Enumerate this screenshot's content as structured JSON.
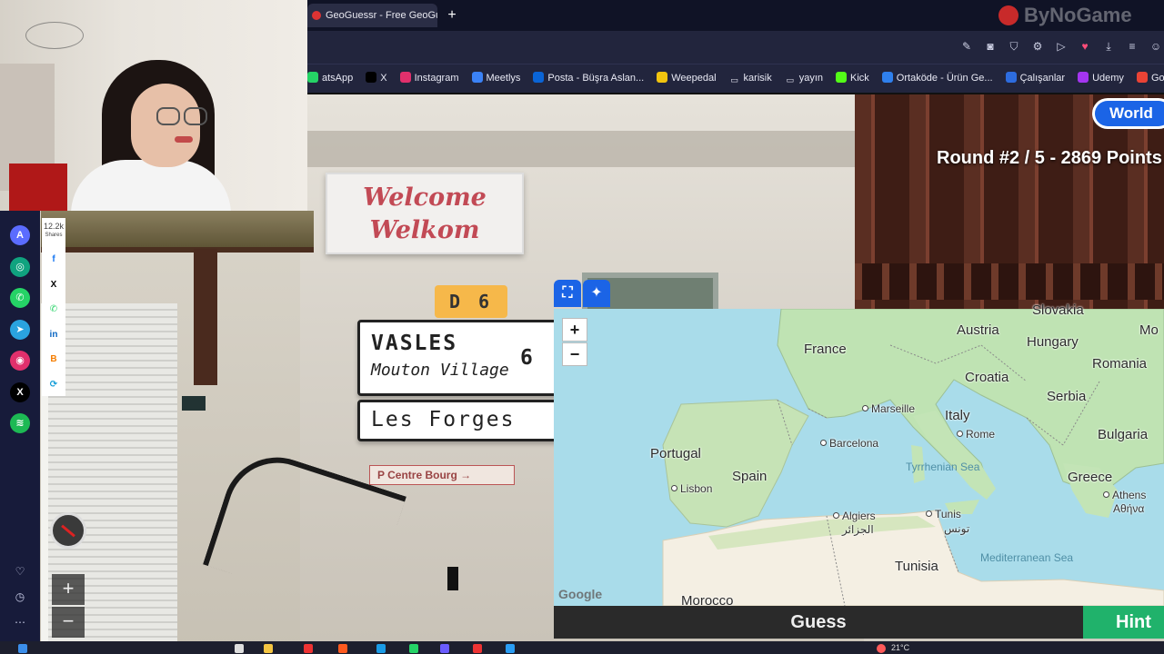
{
  "browser": {
    "active_tab_title": "GeoGuessr - Free GeoGu",
    "new_tab": "+",
    "watermark": "ByNoGame",
    "toolbar_icons": [
      "edit-icon",
      "camera-icon",
      "shield-icon",
      "translate-icon",
      "play-icon",
      "heart-icon",
      "download-icon",
      "menu-icon",
      "profile-icon"
    ]
  },
  "bookmarks": [
    {
      "label": "atsApp",
      "icon": "whatsapp-icon",
      "color": "#25d366"
    },
    {
      "label": "X",
      "icon": "x-icon",
      "color": "#000000"
    },
    {
      "label": "Instagram",
      "icon": "instagram-icon",
      "color": "#e1306c"
    },
    {
      "label": "Meetlys",
      "icon": "meetlys-icon",
      "color": "#3b82f6"
    },
    {
      "label": "Posta - Büşra Aslan...",
      "icon": "outlook-icon",
      "color": "#0a64d6"
    },
    {
      "label": "Weepedal",
      "icon": "weepedal-icon",
      "color": "#f1c40f"
    },
    {
      "label": "karisik",
      "icon": "folder-icon",
      "color": "#22253d"
    },
    {
      "label": "yayın",
      "icon": "folder-icon",
      "color": "#22253d"
    },
    {
      "label": "Kick",
      "icon": "kick-icon",
      "color": "#53fc18"
    },
    {
      "label": "Ortaköde - Ürün Ge...",
      "icon": "ortakode-icon",
      "color": "#2f80ed"
    },
    {
      "label": "Çalışanlar",
      "icon": "calendar-icon",
      "color": "#2d6cdf"
    },
    {
      "label": "Udemy",
      "icon": "udemy-icon",
      "color": "#a435f0"
    },
    {
      "label": "Google Haritalar",
      "icon": "maps-pin-icon",
      "color": "#ea4335"
    }
  ],
  "share": {
    "count": "12.2k",
    "count_label": "Shares",
    "sidebar_icons": [
      {
        "icon": "arc-icon",
        "color": "#5b6cff",
        "glyph": "A"
      },
      {
        "icon": "chatgpt-icon",
        "color": "#10a37f",
        "glyph": "◎"
      },
      {
        "icon": "whatsapp-icon",
        "color": "#25d366",
        "glyph": "✆"
      },
      {
        "icon": "telegram-icon",
        "color": "#2aa3df",
        "glyph": "➤"
      },
      {
        "icon": "instagram-icon",
        "color": "#e1306c",
        "glyph": "◉"
      },
      {
        "icon": "x-icon",
        "color": "#000000",
        "glyph": "X"
      },
      {
        "icon": "spotify-icon",
        "color": "#1db954",
        "glyph": "≋"
      }
    ],
    "panel_icons": [
      {
        "icon": "facebook-icon",
        "color": "#1877f2",
        "glyph": "f"
      },
      {
        "icon": "x-icon",
        "color": "#000000",
        "glyph": "X"
      },
      {
        "icon": "whatsapp-icon",
        "color": "#25d366",
        "glyph": "✆"
      },
      {
        "icon": "linkedin-icon",
        "color": "#0a66c2",
        "glyph": "in"
      },
      {
        "icon": "blogger-icon",
        "color": "#f57d00",
        "glyph": "B"
      },
      {
        "icon": "share-icon",
        "color": "#0f9bd7",
        "glyph": "⟳"
      }
    ]
  },
  "scene": {
    "welcome_line1": "Welcome",
    "welcome_line2": "Welkom",
    "road_number": "D 6",
    "sign1_town": "VASLES",
    "sign1_sub": "Mouton Village",
    "sign1_distance": "6",
    "sign2_town": "Les Forges",
    "sign3": "P Centre Bourg →"
  },
  "game": {
    "mode_button": "World",
    "round_info": "Round #2 / 5 - 2869 Points",
    "zoom_in": "+",
    "zoom_out": "−",
    "guess_button": "Guess",
    "hint_button": "Hint"
  },
  "map": {
    "zoom_in": "+",
    "zoom_out": "−",
    "attribution": "Google",
    "countries": [
      "France",
      "Austria",
      "Hungary",
      "Romania",
      "Croatia",
      "Serbia",
      "Italy",
      "Bulgaria",
      "Portugal",
      "Spain",
      "Greece",
      "Tunisia",
      "Morocco",
      "Slovakia",
      "Mo"
    ],
    "cities": [
      "Marseille",
      "Barcelona",
      "Rome",
      "Lisbon",
      "Algiers",
      "الجزائر",
      "Tunis",
      "تونس",
      "Athens",
      "Αθήνα"
    ],
    "seas": [
      "Tyrrhenian Sea",
      "Mediterranean Sea"
    ]
  },
  "taskbar": {
    "temperature": "21°C"
  },
  "colors": {
    "accent_blue": "#1b64e6",
    "hint_green": "#20b26b",
    "browser_dark": "#22253d"
  }
}
